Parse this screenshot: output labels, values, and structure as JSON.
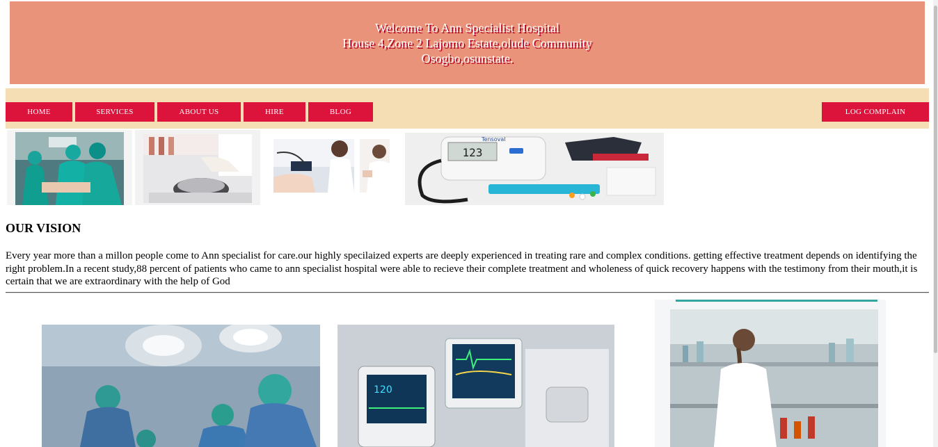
{
  "banner": {
    "line1": "Welcome To Ann Specialist Hospital",
    "line2": "House 4,Zone 2 Lajomo Estate,olude Community",
    "line3": "Osogbo,osunstate."
  },
  "nav": {
    "items": [
      {
        "label": "HOME"
      },
      {
        "label": "SERVICES"
      },
      {
        "label": "ABOUT US"
      },
      {
        "label": "HIRE"
      },
      {
        "label": "BLOG"
      }
    ],
    "complain": "LOG COMPLAIN"
  },
  "images": {
    "monitor_display": "123",
    "monitor_brand": "Tensoval"
  },
  "vision": {
    "title": "OUR VISION",
    "text": "Every year more than a millon people come to Ann specialist for care.our highly specilaized experts are deeply experienced in treating rare and complex conditions. getting effective treatment depends on identifying the right problem.In a recent study,88 percent of patients who came to ann specialist hospital were able to recieve their complete treatment and wholeness of quick recovery happens with the testimony from their mouth,it is certain that we are extraordinary with the help of God"
  },
  "colors": {
    "banner_bg": "#e9937a",
    "nav_bg": "#f5deb3",
    "button_bg": "#dc143c"
  }
}
